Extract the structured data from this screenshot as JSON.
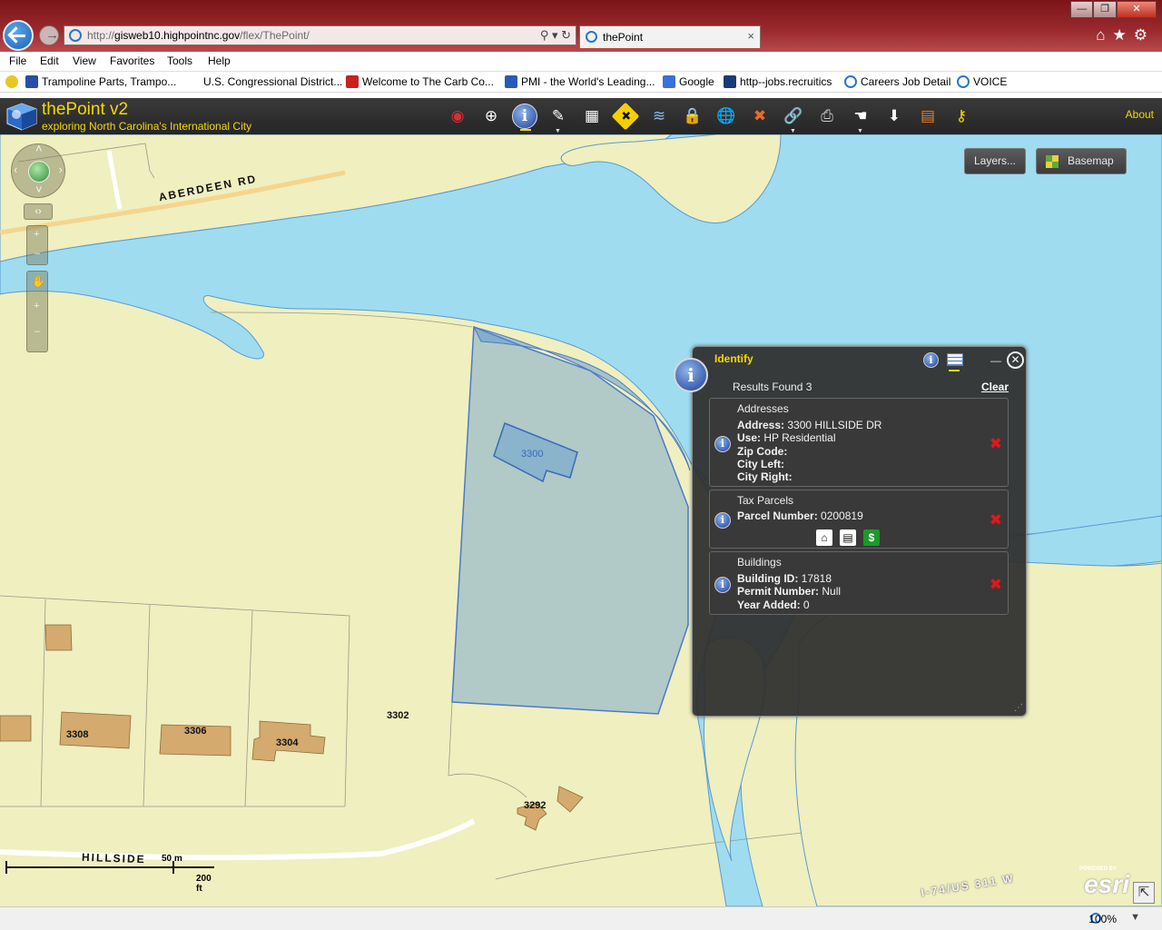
{
  "browser": {
    "address_prefix": "http://",
    "address_host": "gisweb10.highpointnc.gov",
    "address_path": "/flex/ThePoint/",
    "addr_controls": "⚲ ▾ ↻",
    "tab_label": "thePoint",
    "tab_close": "×",
    "back": "←",
    "forward": "→",
    "win_min": "—",
    "win_max": "❐",
    "win_close": "✕",
    "tool_icons": "⌂★⚙",
    "menu": [
      "File",
      "Edit",
      "View",
      "Favorites",
      "Tools",
      "Help"
    ],
    "favorites": [
      "Trampoline Parts, Trampo...",
      "U.S. Congressional District...",
      "Welcome to The Carb Co...",
      "PMI - the World's Leading...",
      "Google",
      "http--jobs.recruitics",
      "Careers  Job Detail",
      "VOICE"
    ],
    "zoom_level": "100%",
    "zoom_caret": "▼"
  },
  "app": {
    "title": "thePoint v2",
    "subtitle": "exploring North Carolina's International City",
    "about": "About",
    "tools": [
      {
        "name": "bookmark-tool-icon",
        "glyph": "◉",
        "color": "#d83030"
      },
      {
        "name": "coordinate-tool-icon",
        "glyph": "⊕",
        "color": "#ffffff"
      },
      {
        "name": "identify-tool-icon",
        "glyph": "i",
        "color": "#ffffff"
      },
      {
        "name": "draw-tool-icon",
        "glyph": "✎",
        "color": "#ffffff"
      },
      {
        "name": "table-tool-icon",
        "glyph": "▦",
        "color": "#ffffff"
      },
      {
        "name": "navigation-tool-icon",
        "glyph": "✚",
        "color": "#111111"
      },
      {
        "name": "layers-tool-icon",
        "glyph": "≋",
        "color": "#88bbee"
      },
      {
        "name": "lock-tool-icon",
        "glyph": "🔒",
        "color": "#f6c800"
      },
      {
        "name": "globe-tool-icon",
        "glyph": "🌐",
        "color": "#55aa55"
      },
      {
        "name": "measure-tool-icon",
        "glyph": "✖",
        "color": "#e86a2a"
      },
      {
        "name": "link-tool-icon",
        "glyph": "🔗",
        "color": "#aaccee"
      },
      {
        "name": "print-tool-icon",
        "glyph": "⎙",
        "color": "#cccccc"
      },
      {
        "name": "pointer-tool-icon",
        "glyph": "☚",
        "color": "#ffffff"
      },
      {
        "name": "download-tool-icon",
        "glyph": "⬇",
        "color": "#ffffff"
      },
      {
        "name": "report-tool-icon",
        "glyph": "▤",
        "color": "#e8802a"
      },
      {
        "name": "key-tool-icon",
        "glyph": "⚷",
        "color": "#f6d800"
      }
    ]
  },
  "map": {
    "layers_button": "Layers...",
    "basemap_button": "Basemap",
    "road_labels": [
      "ABERDEEN RD",
      "HILLSIDE",
      "I-74/US 311 W"
    ],
    "parcel_labels": [
      "3300",
      "3302",
      "3304",
      "3306",
      "3308",
      "3292"
    ],
    "scale_top": "50 m",
    "scale_bottom": "200 ft",
    "esri_powered": "POWERED BY",
    "esri_logo": "esri",
    "corner_arrow": "⇱",
    "pan_arrows": [
      "‹",
      "›",
      "˄",
      "˅"
    ],
    "nav_glyphs": [
      "‹›",
      "+",
      "–",
      "✋",
      "+",
      "–"
    ]
  },
  "identify": {
    "title": "Identify",
    "badge": "i",
    "info_icon": "i",
    "minimize": "—",
    "close": "✕",
    "results_found": "Results Found 3",
    "clear": "Clear",
    "resize_grip": "⋰",
    "delete_glyph": "✖",
    "results": [
      {
        "title": "Addresses",
        "lines": [
          {
            "label": "Address:",
            "value": " 3300 HILLSIDE DR"
          },
          {
            "label": "Use:",
            "value": " HP Residential"
          },
          {
            "label": "Zip Code:",
            "value": ""
          },
          {
            "label": "City Left:",
            "value": ""
          },
          {
            "label": "City Right:",
            "value": ""
          }
        ]
      },
      {
        "title": "Tax Parcels",
        "lines": [
          {
            "label": "Parcel Number:",
            "value": " 0200819"
          }
        ],
        "links": [
          "⌂",
          "▤",
          "$"
        ]
      },
      {
        "title": "Buildings",
        "lines": [
          {
            "label": "Building ID:",
            "value": " 17818"
          },
          {
            "label": "Permit Number:",
            "value": " Null"
          },
          {
            "label": "Year Added:",
            "value": " 0"
          }
        ]
      }
    ]
  }
}
